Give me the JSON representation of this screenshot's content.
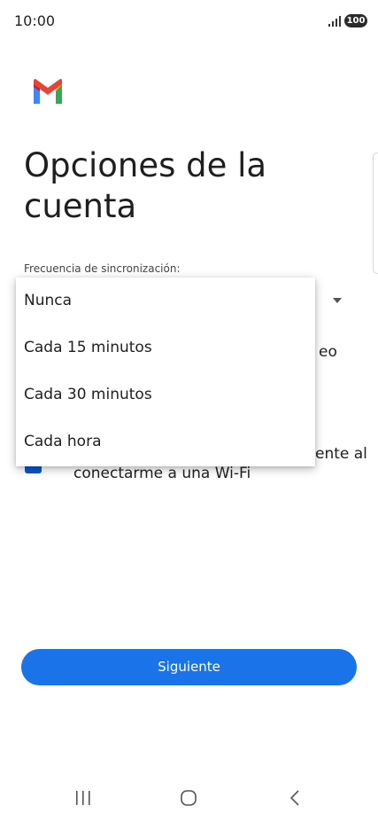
{
  "status_bar": {
    "time": "10:00",
    "battery": "100"
  },
  "page": {
    "title": "Opciones de la cuenta",
    "sync_frequency_label": "Frecuencia de sincronización:",
    "behind_fragments": {
      "notify_fragment": "eo",
      "wifi_fragment_a": "ente al",
      "wifi_fragment_b": "conectarme a una Wi-Fi"
    },
    "wifi_checkbox_checked": true
  },
  "dropdown": {
    "options": [
      "Nunca",
      "Cada 15 minutos",
      "Cada 30 minutos",
      "Cada hora"
    ]
  },
  "footer": {
    "next_label": "Siguiente"
  },
  "colors": {
    "primary": "#1a73e8",
    "checkbox": "#0b57d0"
  },
  "icons": {
    "logo": "gmail-logo",
    "signal": "signal-icon",
    "dropdown": "dropdown-arrow-icon",
    "nav_recent": "recent-apps-icon",
    "nav_home": "home-icon",
    "nav_back": "back-icon"
  }
}
